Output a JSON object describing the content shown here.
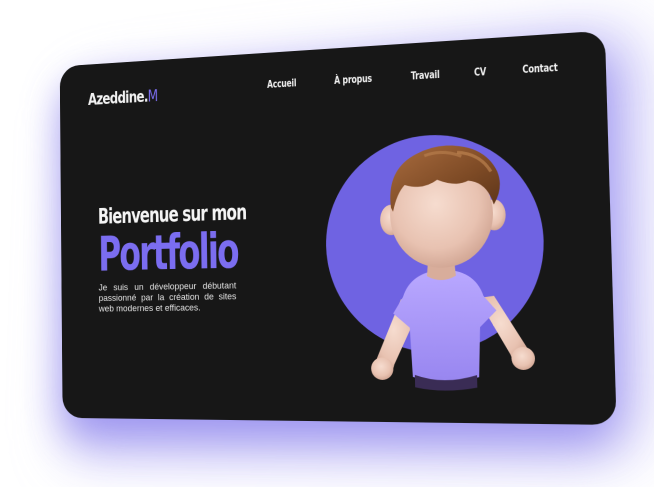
{
  "logo": {
    "text": "Azeddine.",
    "accent": "M"
  },
  "nav": {
    "items": [
      "Accueil",
      "À propus",
      "Travail",
      "CV",
      "Contact"
    ]
  },
  "hero": {
    "headline_line1": "Bienvenue sur mon",
    "headline_line2": "Portfolio",
    "description": "Je suis un développeur débutant passionné par la création de sites web modernes et efficaces."
  },
  "colors": {
    "card_background": "#171717",
    "accent": "#7b6df0",
    "circle": "#6f63e2",
    "glow": "#8d83f0"
  },
  "icons": {
    "avatar": "3d-avatar-illustration"
  }
}
